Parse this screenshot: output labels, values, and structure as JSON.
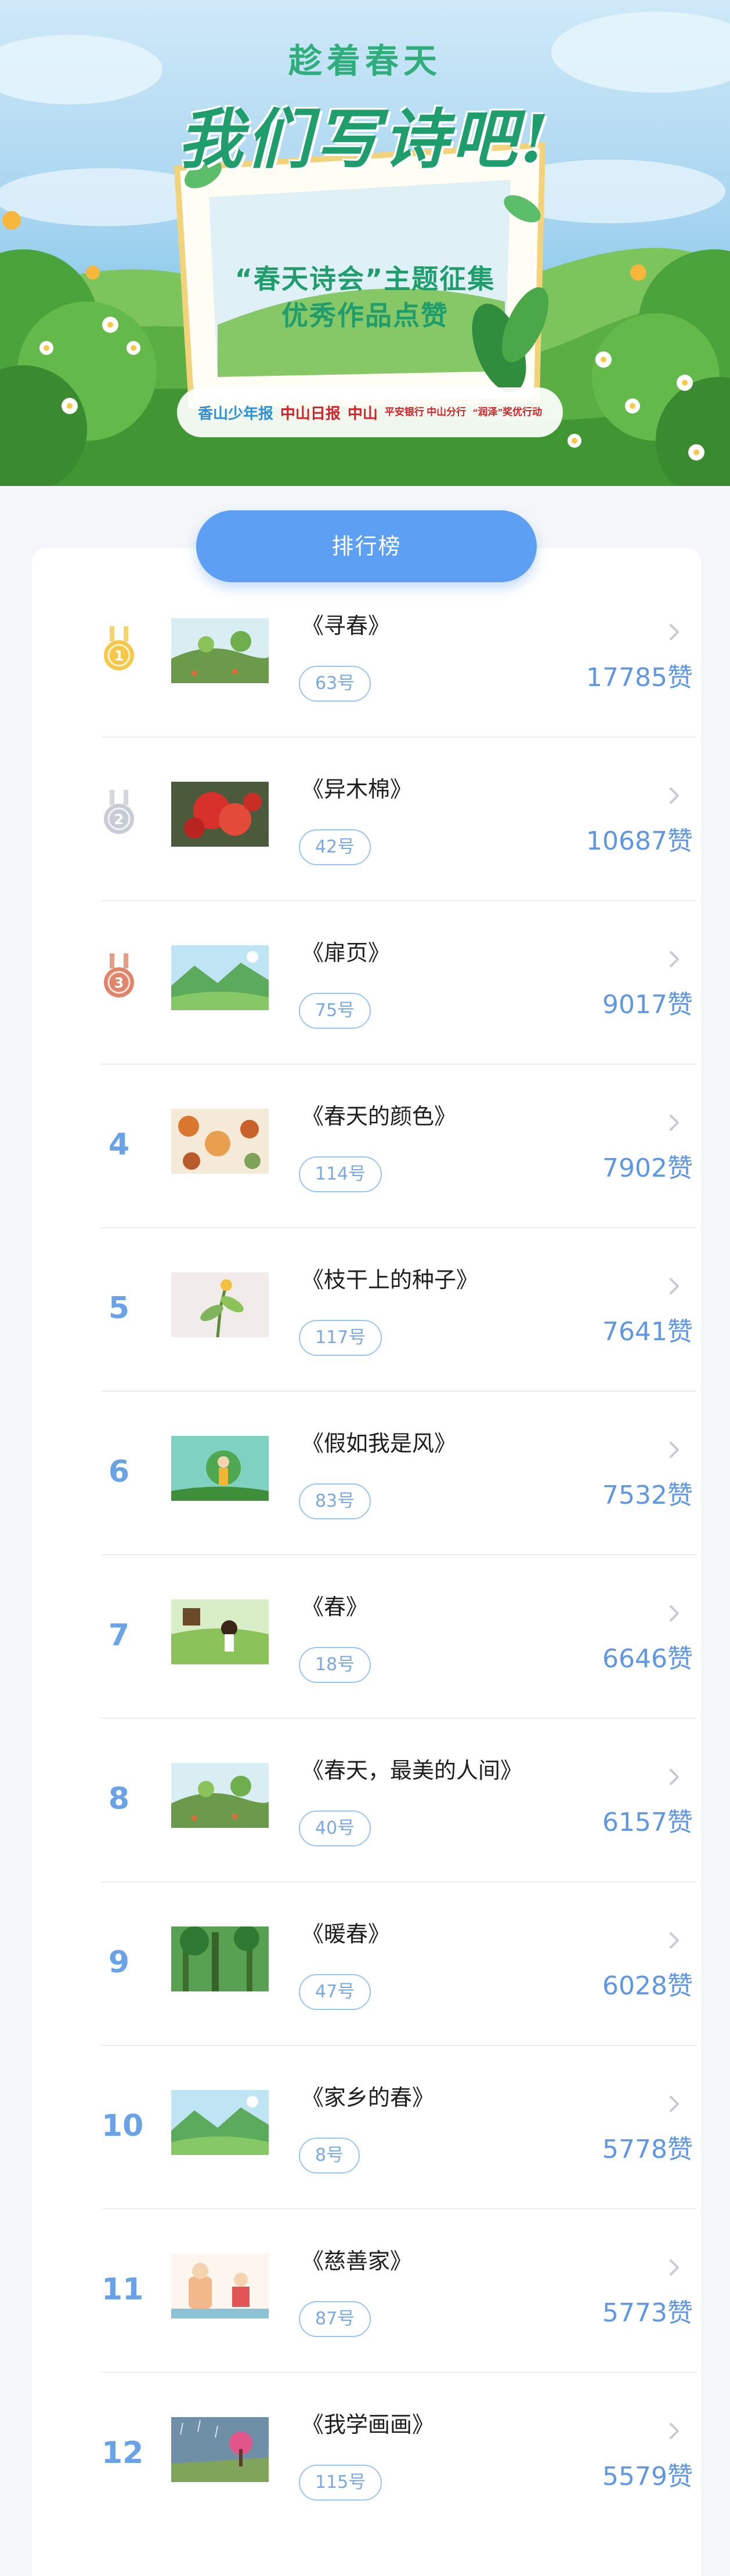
{
  "banner": {
    "pre_title": "趁着春天",
    "main_title": "我们写诗吧!",
    "subtitle_line1": "“春天诗会”主题征集",
    "subtitle_line2": "优秀作品点赞",
    "sponsors": [
      "香山少年报",
      "中山日报",
      "中山",
      "平安银行 中山分行",
      "“润泽”奖优行动"
    ]
  },
  "tab": {
    "label": "排行榜"
  },
  "colors": {
    "accent": "#5c9ff3",
    "likes": "#5f97e4",
    "gold": "#f5c84a",
    "silver": "#c8ccd4",
    "bronze": "#e0856a"
  },
  "ranking": [
    {
      "rank": "1",
      "medal": "gold",
      "title": "《寻春》",
      "id": "63号",
      "likes": "17785赞",
      "thumb": "hill-trees"
    },
    {
      "rank": "2",
      "medal": "silver",
      "title": "《异木棉》",
      "id": "42号",
      "likes": "10687赞",
      "thumb": "red-flowers"
    },
    {
      "rank": "3",
      "medal": "bronze",
      "title": "《扉页》",
      "id": "75号",
      "likes": "9017赞",
      "thumb": "green-mountains"
    },
    {
      "rank": "4",
      "medal": "",
      "title": "《春天的颜色》",
      "id": "114号",
      "likes": "7902赞",
      "thumb": "autumn-pattern"
    },
    {
      "rank": "5",
      "medal": "",
      "title": "《枝干上的种子》",
      "id": "117号",
      "likes": "7641赞",
      "thumb": "seed-branch"
    },
    {
      "rank": "6",
      "medal": "",
      "title": "《假如我是风》",
      "id": "83号",
      "likes": "7532赞",
      "thumb": "wind-child"
    },
    {
      "rank": "7",
      "medal": "",
      "title": "《春》",
      "id": "18号",
      "likes": "6646赞",
      "thumb": "girl-meadow"
    },
    {
      "rank": "8",
      "medal": "",
      "title": "《春天，最美的人间》",
      "id": "40号",
      "likes": "6157赞",
      "thumb": "hill-trees"
    },
    {
      "rank": "9",
      "medal": "",
      "title": "《暖春》",
      "id": "47号",
      "likes": "6028赞",
      "thumb": "forest"
    },
    {
      "rank": "10",
      "medal": "",
      "title": "《家乡的春》",
      "id": "8号",
      "likes": "5778赞",
      "thumb": "green-mountains"
    },
    {
      "rank": "11",
      "medal": "",
      "title": "《慈善家》",
      "id": "87号",
      "likes": "5773赞",
      "thumb": "kids-room"
    },
    {
      "rank": "12",
      "medal": "",
      "title": "《我学画画》",
      "id": "115号",
      "likes": "5579赞",
      "thumb": "rain-tree"
    }
  ]
}
